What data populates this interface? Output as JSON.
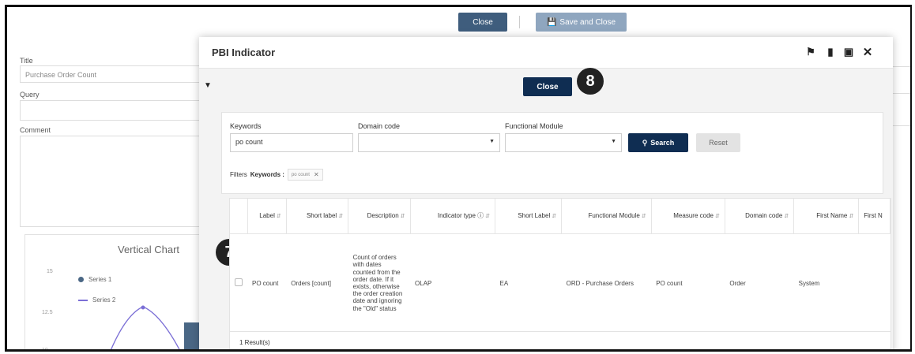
{
  "background": {
    "close_label": "Close",
    "save_close_label": "Save and Close",
    "title_label": "Title",
    "title_value": "Purchase Order Count",
    "query_label": "Query",
    "comment_label": "Comment",
    "chart_title": "Vertical Chart",
    "legend": [
      "Series 1",
      "Series 2"
    ],
    "y_ticks": [
      "15",
      "12.5",
      "10"
    ],
    "series_colors": [
      "#4a6785",
      "#7b6fd6"
    ]
  },
  "modal": {
    "title": "PBI Indicator",
    "header_icons": [
      "pin-icon",
      "clipboard-icon",
      "maximize-icon",
      "close-icon"
    ],
    "close_label": "Close",
    "badge_8": "8",
    "badge_7": "7"
  },
  "search": {
    "keywords_label": "Keywords",
    "keywords_value": "po count",
    "domain_label": "Domain code",
    "domain_value": "",
    "module_label": "Functional Module",
    "module_value": "",
    "search_label": "Search",
    "reset_label": "Reset",
    "filters_label": "Filters",
    "filter_key": "Keywords :",
    "filter_value": "po count"
  },
  "table": {
    "columns": [
      "Label",
      "Short label",
      "Description",
      "Indicator type ⓘ",
      "Short Label",
      "Functional Module",
      "Measure code",
      "Domain code",
      "First Name",
      "First N"
    ],
    "rows": [
      {
        "label": "PO count",
        "short_label": "Orders [count]",
        "description": "Count of orders with dates counted from the order date. If it exists, otherwise the order creation date and ignoring the \"Old\" status",
        "indicator_type": "OLAP",
        "short_label2": "EA",
        "functional_module": "ORD - Purchase Orders",
        "measure_code": "PO count",
        "domain_code": "Order",
        "first_name": "System",
        "first_n": ""
      }
    ],
    "result_count": "1 Result(s)"
  }
}
